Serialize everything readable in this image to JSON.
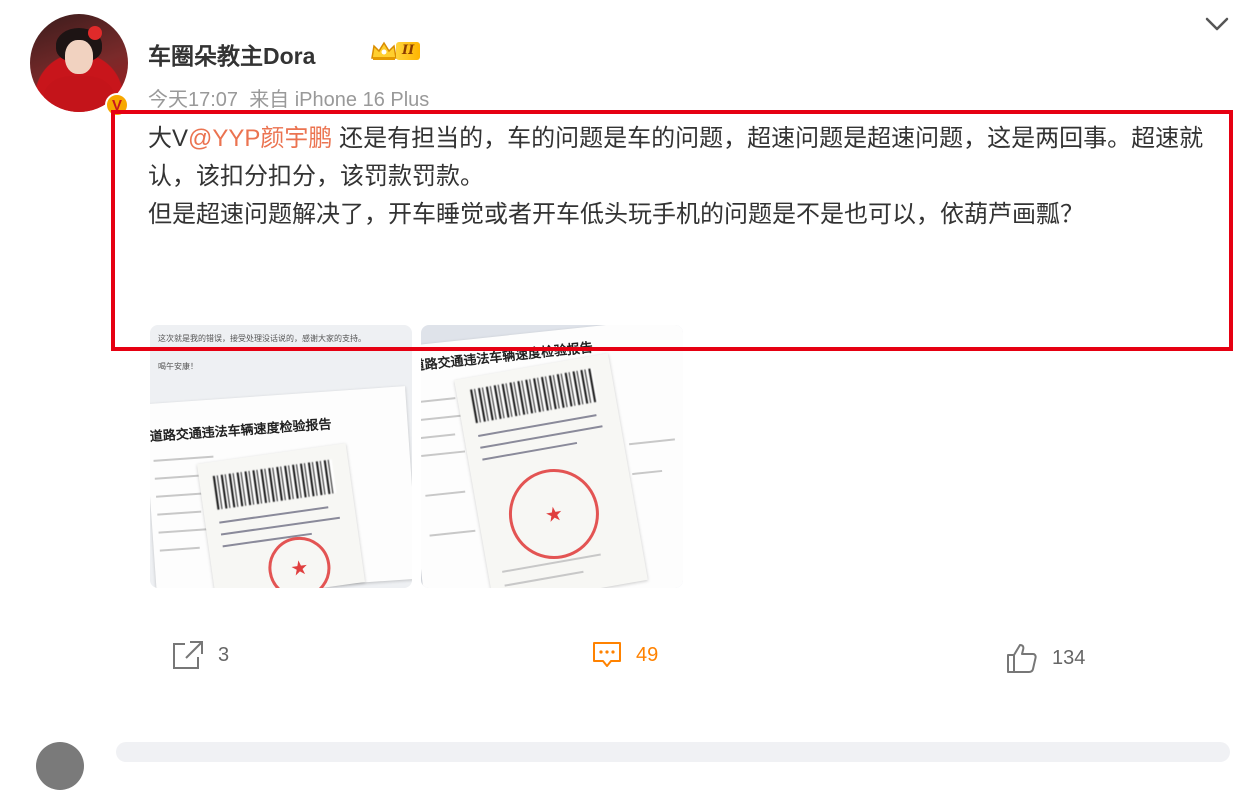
{
  "post": {
    "author": "车圈朵教主Dora",
    "vip_level": "II",
    "verified_badge": "V",
    "time": "今天17:07",
    "source": "来自 iPhone 16 Plus",
    "text": {
      "prefix": "大V",
      "mention": "@YYP颜宇鹏",
      "line1_rest": " 还是有担当的，车的问题是车的问题，超速问题是超速问题，这是两回事。超速就认，该扣分扣分，该罚款罚款。",
      "line2": "但是超速问题解决了，开车睡觉或者开车低头玩手机的问题是不是也可以，依葫芦画瓢？"
    },
    "images": [
      {
        "alt": "speed violation notice photo 1",
        "note1": "这次就是我的错误，接受处理没话说的，感谢大家的支持。",
        "note2": "喝午安康！",
        "doc_title": "道路交通违法车辆速度检验报告"
      },
      {
        "alt": "speed violation notice photo 2",
        "doc_title": "道路交通违法车辆速度检验报告"
      }
    ]
  },
  "actions": {
    "repost_count": "3",
    "comment_count": "49",
    "like_count": "134"
  },
  "colors": {
    "mention": "#eb7350",
    "highlight_border": "#e60012",
    "comment_active": "#ff8200",
    "meta": "#999999"
  },
  "icons": {
    "more": "chevron-down-icon",
    "repost": "repost-icon",
    "comment": "comment-icon",
    "like": "thumbs-up-icon",
    "vip": "crown-icon"
  }
}
